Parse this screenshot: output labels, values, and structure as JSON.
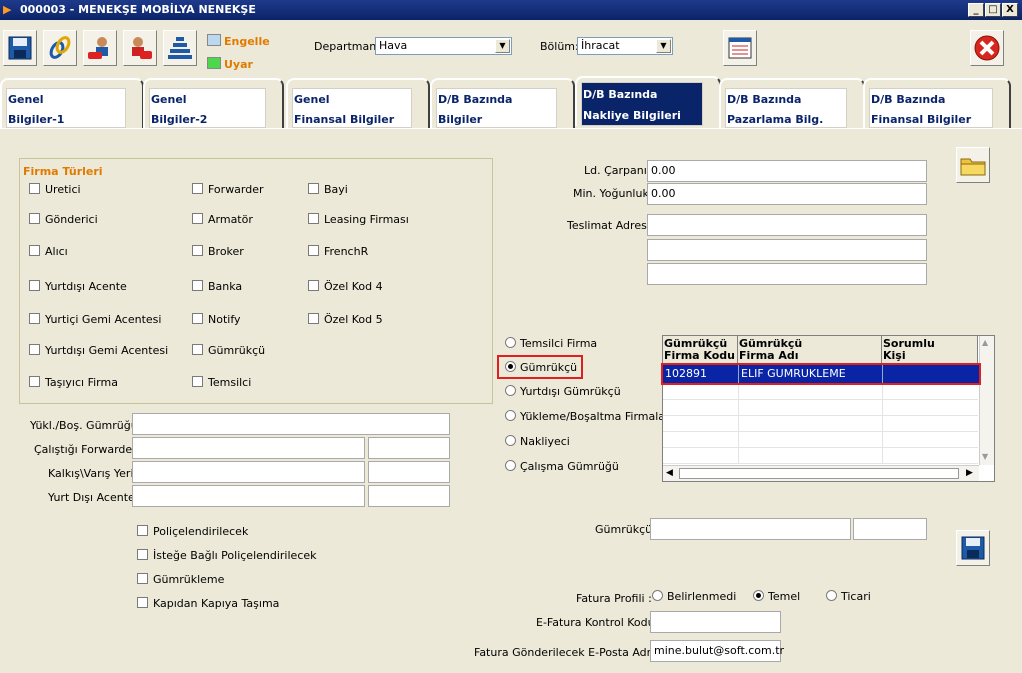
{
  "window": {
    "title": "000003 - MENEKŞE MOBİLYA NENEKŞE",
    "min": "_",
    "max": "□",
    "close": "X"
  },
  "toolbar": {
    "engelle": "Engelle",
    "uyar": "Uyar",
    "departman_label": "Departman:",
    "departman_value": "Hava",
    "bolum_label": "Bölüm:",
    "bolum_value": "İhracat"
  },
  "tabs": [
    {
      "l1": "Genel",
      "l2": "Bilgiler-1"
    },
    {
      "l1": "Genel",
      "l2": "Bilgiler-2"
    },
    {
      "l1": "Genel",
      "l2": "Finansal Bilgiler"
    },
    {
      "l1": "D/B Bazında",
      "l2": "Bilgiler"
    },
    {
      "l1": "D/B Bazında",
      "l2": "Nakliye Bilgileri"
    },
    {
      "l1": "D/B Bazında",
      "l2": "Pazarlama Bilg."
    },
    {
      "l1": "D/B Bazında",
      "l2": "Finansal Bilgiler"
    }
  ],
  "firma_turleri": {
    "title": "Firma Türleri",
    "col1": [
      "Uretici",
      "Gönderici",
      "Alıcı",
      "Yurtdışı Acente",
      "Yurtiçi Gemi Acentesi",
      "Yurtdışı Gemi Acentesi",
      "Taşıyıcı Firma"
    ],
    "col2": [
      "Forwarder",
      "Armatör",
      "Broker",
      "Banka",
      "Notify",
      "Gümrükçü",
      "Temsilci"
    ],
    "col3": [
      "Bayi",
      "Leasing Firması",
      "FrenchR",
      "Özel Kod 4",
      "Özel Kod 5"
    ]
  },
  "left_fields": {
    "yukl": "Yükl./Boş. Gümrüğü:",
    "forwarder": "Çalıştığı Forwarder:",
    "kalkis": "Kalkış\\Varış Yeri:",
    "acente": "Yurt Dışı Acente:"
  },
  "options": [
    "Poliçelendirilecek",
    "İsteğe Bağlı Poliçelendirilecek",
    "Gümrükleme",
    "Kapıdan Kapıya Taşıma"
  ],
  "right_fields": {
    "ld_label": "Ld. Çarpanı:",
    "ld_value": "0.00",
    "min_label": "Min. Yoğunluk:",
    "min_value": "0.00",
    "teslimat_label": "Teslimat Adresi:"
  },
  "radios": [
    "Temsilci Firma",
    "Gümrükçü",
    "Yurtdışı Gümrükçü",
    "Yükleme/Boşaltma Firmaları",
    "Nakliyeci",
    "Çalışma Gümrüğü"
  ],
  "grid": {
    "headers": [
      [
        "Gümrükçü",
        "Firma Kodu"
      ],
      [
        "Gümrükçü",
        "Firma Adı"
      ],
      [
        "Sorumlu",
        "Kişi"
      ]
    ],
    "row": [
      "102891",
      "ELIF GUMRUKLEME",
      ""
    ]
  },
  "gumrukcu_label": "Gümrükçü:",
  "fatura": {
    "profil_label": "Fatura Profili :",
    "opt1": "Belirlenmedi",
    "opt2": "Temel",
    "opt3": "Ticari",
    "kontrol_label": "E-Fatura Kontrol Kodu:",
    "eposta_label": "Fatura Gönderilecek E-Posta Adresi:",
    "eposta_value": "mine.bulut@soft.com.tr"
  },
  "colors": {
    "title_bar": "#0a246a",
    "accent_orange": "#e07b00",
    "highlight_red": "#e0201e",
    "selection_blue": "#0a24a6"
  }
}
